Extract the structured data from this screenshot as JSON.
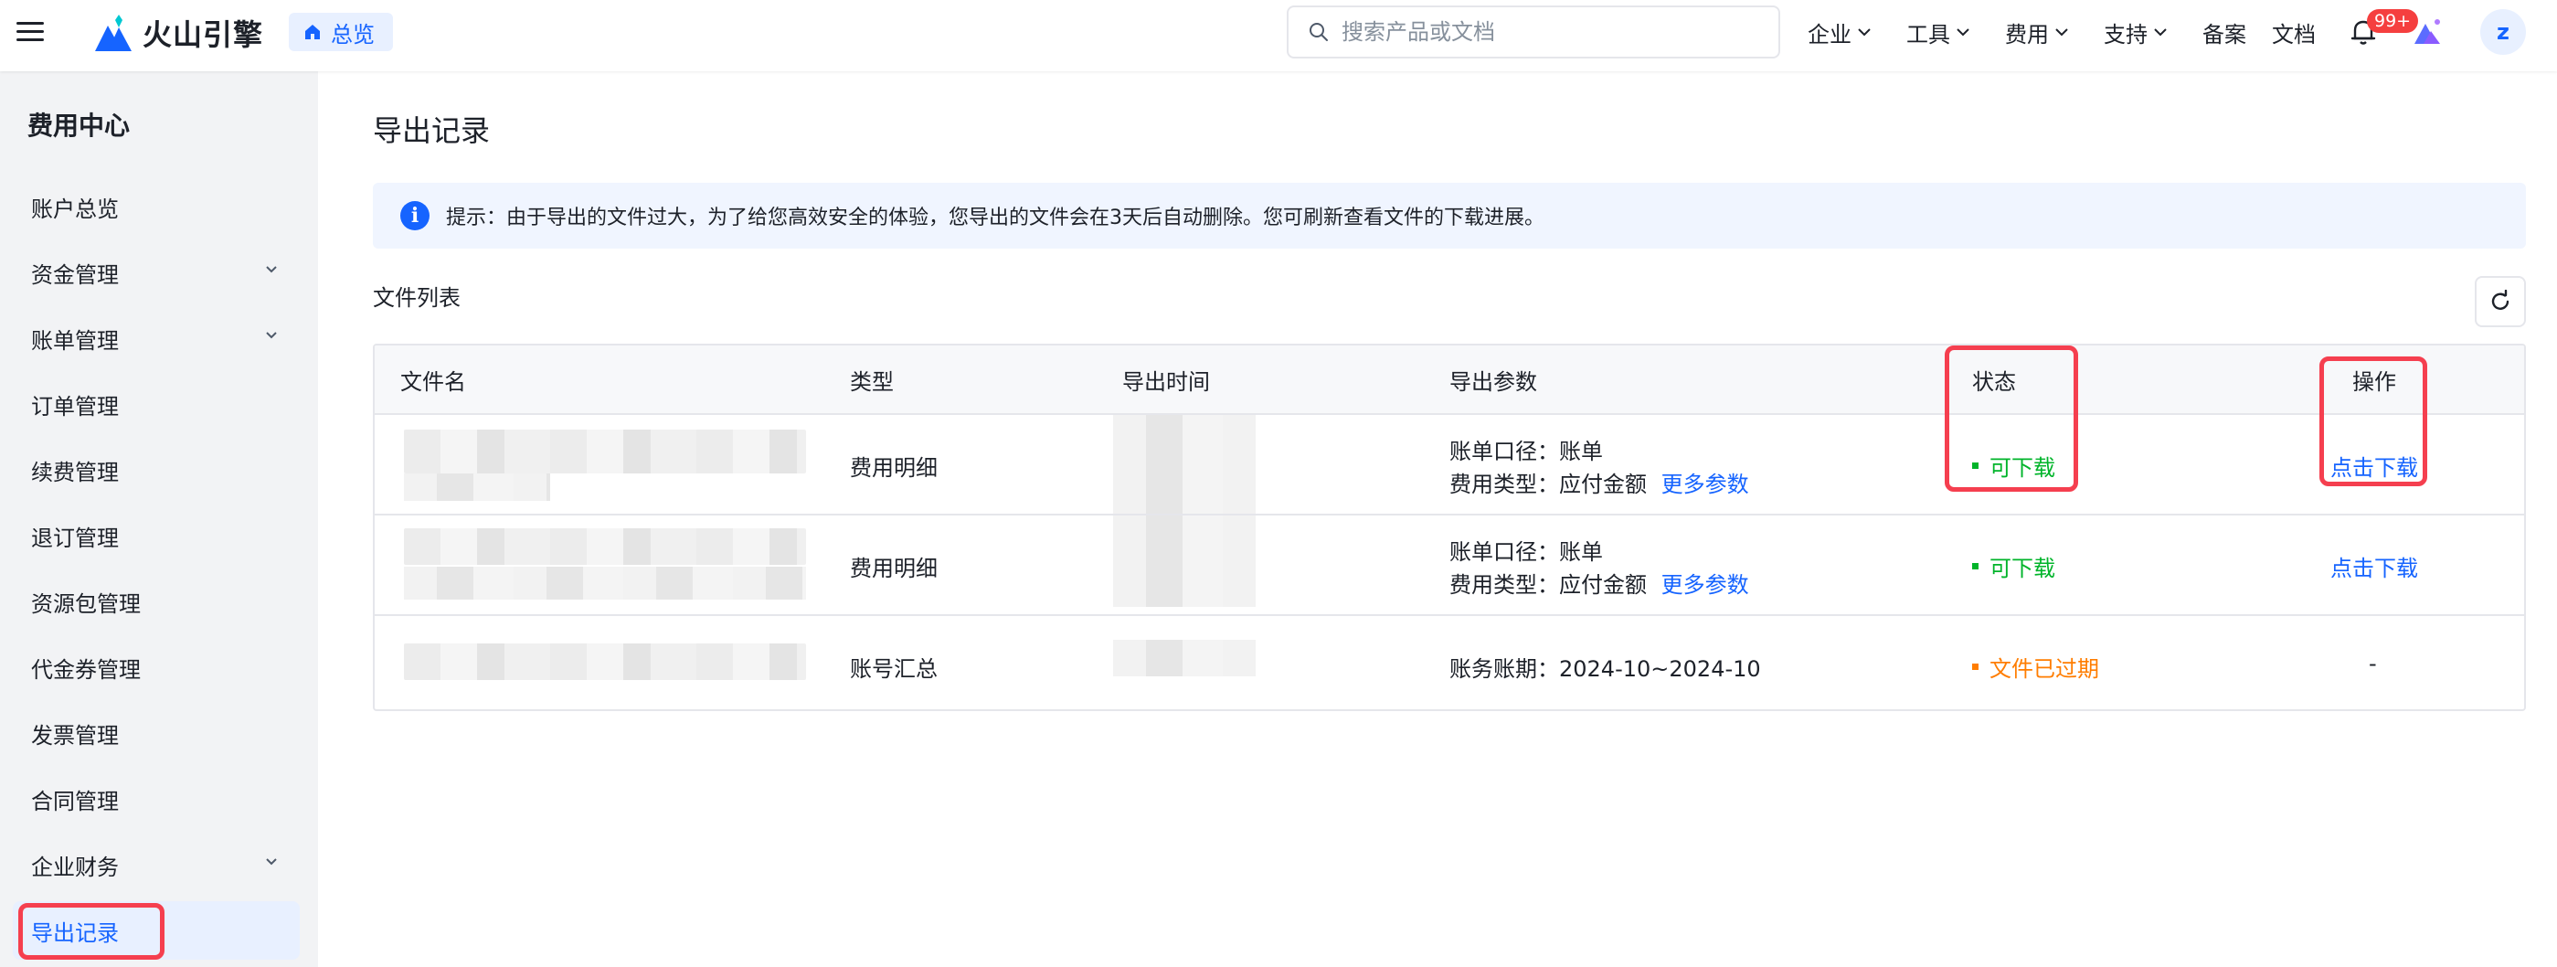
{
  "header": {
    "logo_text": "火山引擎",
    "overview_label": "总览",
    "search_placeholder": "搜索产品或文档",
    "nav": [
      {
        "label": "企业"
      },
      {
        "label": "工具"
      },
      {
        "label": "费用"
      },
      {
        "label": "支持"
      },
      {
        "label": "备案"
      },
      {
        "label": "文档"
      }
    ],
    "notification_count": "99+",
    "avatar_letter": "z"
  },
  "sidebar": {
    "title": "费用中心",
    "items": [
      {
        "label": "账户总览"
      },
      {
        "label": "资金管理"
      },
      {
        "label": "账单管理"
      },
      {
        "label": "订单管理"
      },
      {
        "label": "续费管理"
      },
      {
        "label": "退订管理"
      },
      {
        "label": "资源包管理"
      },
      {
        "label": "代金券管理"
      },
      {
        "label": "发票管理"
      },
      {
        "label": "合同管理"
      },
      {
        "label": "企业财务"
      },
      {
        "label": "导出记录"
      }
    ],
    "active_item": "导出记录"
  },
  "main": {
    "page_title": "导出记录",
    "notice": "提示：由于导出的文件过大，为了给您高效安全的体验，您导出的文件会在3天后自动删除。您可刷新查看文件的下载进展。",
    "file_list_title": "文件列表",
    "table": {
      "columns": [
        "文件名",
        "类型",
        "导出时间",
        "导出参数",
        "状态",
        "操作"
      ],
      "rows": [
        {
          "type": "费用明细",
          "param_line1": "账单口径：账单",
          "param_line2": "费用类型：应付金额",
          "more_params": "更多参数",
          "status": "可下载",
          "action": "点击下载"
        },
        {
          "type": "费用明细",
          "param_line1": "账单口径：账单",
          "param_line2": "费用类型：应付金额",
          "more_params": "更多参数",
          "status": "可下载",
          "action": "点击下载"
        },
        {
          "type": "账号汇总",
          "param_line1": "账务账期：2024-10~2024-10",
          "status": "文件已过期",
          "action": "-"
        }
      ]
    }
  },
  "colors": {
    "accent": "#1664ff",
    "success": "#00b42a",
    "warning": "#ff7d00",
    "highlight": "#f53f4f"
  }
}
